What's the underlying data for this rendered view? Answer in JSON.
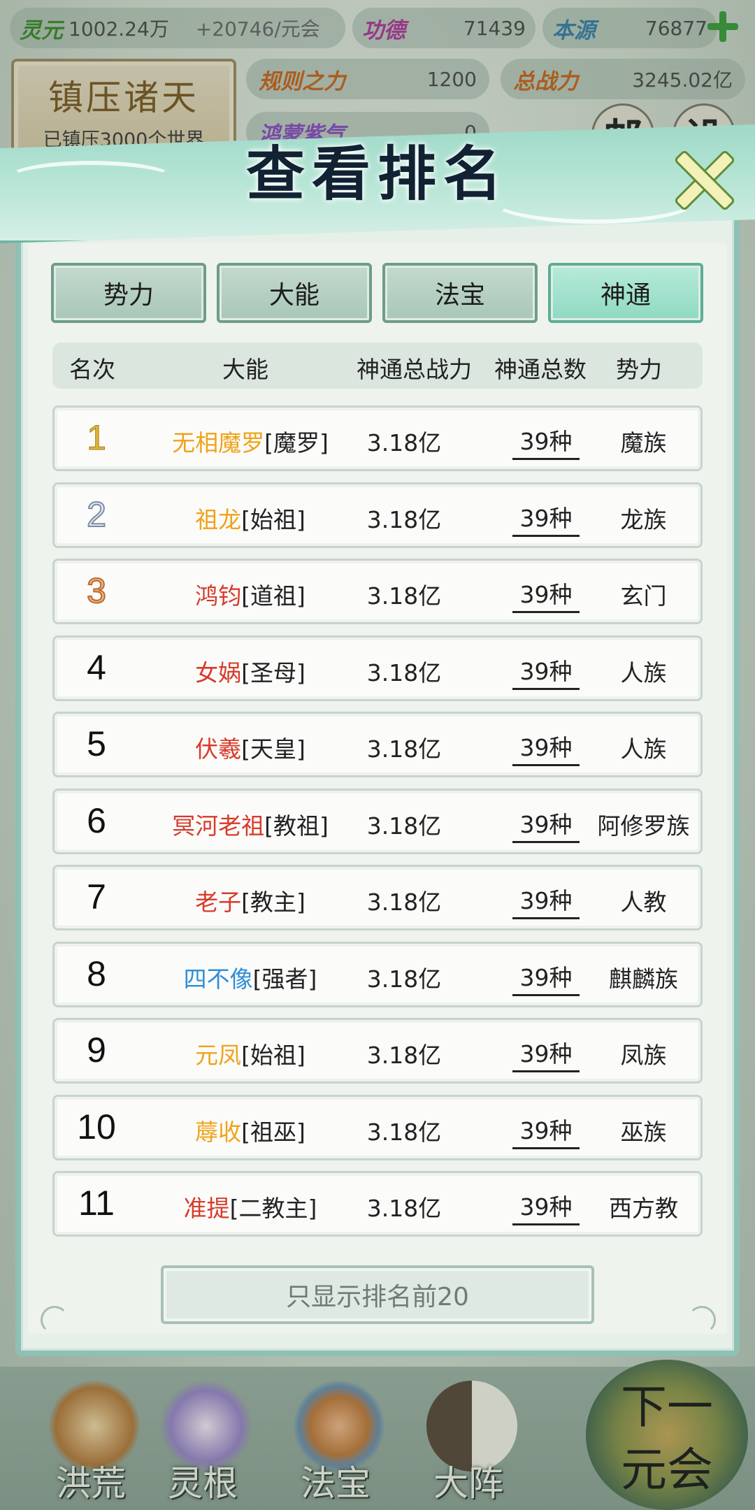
{
  "topbar": {
    "lingyuan": {
      "name": "灵元",
      "value": "1002.24万",
      "rate": "+20746/元会"
    },
    "gongde": {
      "name": "功德",
      "value": "71439"
    },
    "benyuan": {
      "name": "本源",
      "value": "76877"
    }
  },
  "stamp": {
    "title": "镇压诸天",
    "subtitle": "已镇压3000个世界"
  },
  "stats": {
    "rule_power": {
      "name": "规则之力",
      "value": "1200"
    },
    "total_power": {
      "name": "总战力",
      "value": "3245.02亿"
    },
    "purple_qi": {
      "name": "鸿蒙紫气",
      "value": "0"
    }
  },
  "side_buttons": {
    "mail": "邮",
    "settings": "设"
  },
  "modal": {
    "title": "查看排名",
    "tabs": [
      {
        "label": "势力",
        "active": false
      },
      {
        "label": "大能",
        "active": false
      },
      {
        "label": "法宝",
        "active": false
      },
      {
        "label": "神通",
        "active": true
      }
    ],
    "columns": [
      "名次",
      "大能",
      "神通总战力",
      "神通总数",
      "势力"
    ],
    "rows": [
      {
        "rank": "1",
        "name": "无相魔罗",
        "title": "[魔罗]",
        "name_color": "#f0a21a",
        "power": "3.18亿",
        "count": "39种",
        "faction": "魔族"
      },
      {
        "rank": "2",
        "name": "祖龙",
        "title": "[始祖]",
        "name_color": "#f0a21a",
        "power": "3.18亿",
        "count": "39种",
        "faction": "龙族"
      },
      {
        "rank": "3",
        "name": "鸿钧",
        "title": "[道祖]",
        "name_color": "#d83a2a",
        "power": "3.18亿",
        "count": "39种",
        "faction": "玄门"
      },
      {
        "rank": "4",
        "name": "女娲",
        "title": "[圣母]",
        "name_color": "#d83a2a",
        "power": "3.18亿",
        "count": "39种",
        "faction": "人族"
      },
      {
        "rank": "5",
        "name": "伏羲",
        "title": "[天皇]",
        "name_color": "#d83a2a",
        "power": "3.18亿",
        "count": "39种",
        "faction": "人族"
      },
      {
        "rank": "6",
        "name": "冥河老祖",
        "title": "[教祖]",
        "name_color": "#d83a2a",
        "power": "3.18亿",
        "count": "39种",
        "faction": "阿修罗族"
      },
      {
        "rank": "7",
        "name": "老子",
        "title": "[教主]",
        "name_color": "#d83a2a",
        "power": "3.18亿",
        "count": "39种",
        "faction": "人教"
      },
      {
        "rank": "8",
        "name": "四不像",
        "title": "[强者]",
        "name_color": "#2f8ed8",
        "power": "3.18亿",
        "count": "39种",
        "faction": "麒麟族"
      },
      {
        "rank": "9",
        "name": "元凤",
        "title": "[始祖]",
        "name_color": "#f0a21a",
        "power": "3.18亿",
        "count": "39种",
        "faction": "凤族"
      },
      {
        "rank": "10",
        "name": "蓐收",
        "title": "[祖巫]",
        "name_color": "#f0a21a",
        "power": "3.18亿",
        "count": "39种",
        "faction": "巫族"
      },
      {
        "rank": "11",
        "name": "准提",
        "title": "[二教主]",
        "name_color": "#d83a2a",
        "power": "3.18亿",
        "count": "39种",
        "faction": "西方教"
      }
    ],
    "top20_button": "只显示排名前20"
  },
  "bottom_nav": [
    {
      "label": "洪荒",
      "icon": "mountain-icon"
    },
    {
      "label": "灵根",
      "icon": "lotus-icon"
    },
    {
      "label": "法宝",
      "icon": "treasure-orb-icon"
    },
    {
      "label": "大阵",
      "icon": "yin-yang-icon"
    }
  ],
  "next_button": {
    "line1": "下一",
    "line2": "元会"
  }
}
